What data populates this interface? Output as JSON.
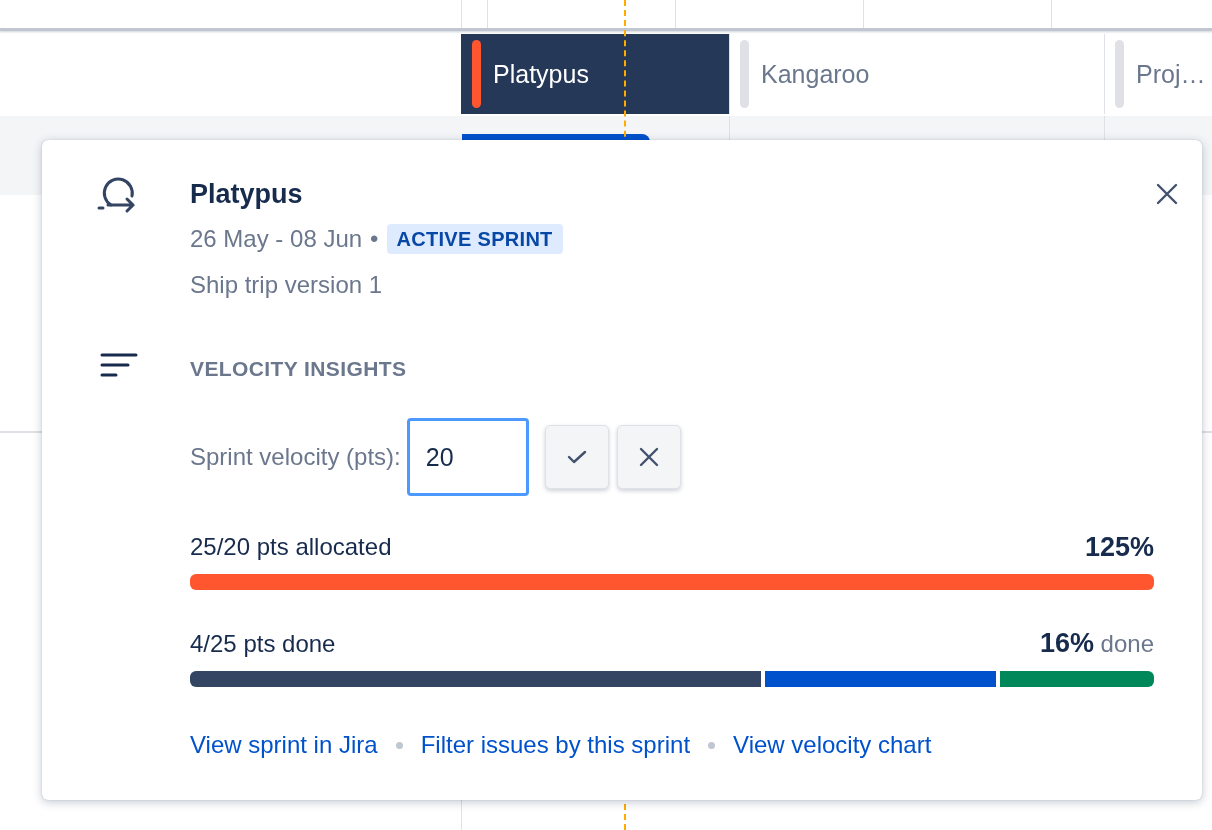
{
  "timeline": {
    "sprints": [
      {
        "name": "Platypus",
        "selected": true,
        "color": "#ff5630"
      },
      {
        "name": "Kangaroo",
        "selected": false,
        "color": "#dfe1e6"
      },
      {
        "name": "Proj…",
        "selected": false,
        "color": "#dfe1e6"
      }
    ]
  },
  "popup": {
    "title": "Platypus",
    "dates": "26 May - 08 Jun",
    "separator": "•",
    "status": "ACTIVE SPRINT",
    "goal": "Ship trip version 1",
    "section_title": "VELOCITY INSIGHTS",
    "velocity_label": "Sprint velocity (pts):",
    "velocity_value": "20",
    "allocated": {
      "label": "25/20 pts allocated",
      "percent": "125%",
      "level": 1,
      "color": "#ff5630"
    },
    "done": {
      "label": "4/25 pts done",
      "percent": "16%",
      "suffix": "done",
      "segments": [
        {
          "color": "#344563"
        },
        {
          "color": "#0052cc"
        },
        {
          "color": "#00875a"
        }
      ]
    },
    "links": [
      "View sprint in Jira",
      "Filter issues by this sprint",
      "View velocity chart"
    ]
  }
}
